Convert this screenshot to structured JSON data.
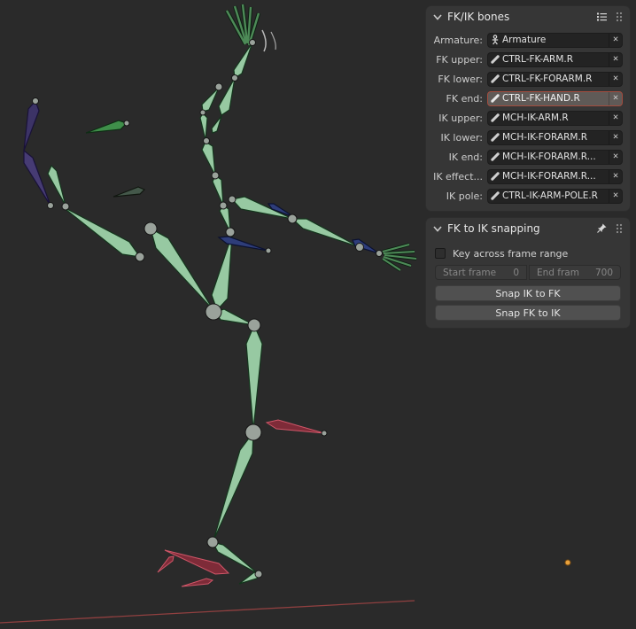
{
  "colors": {
    "viewport_bg": "#2a2a2a",
    "panel_bg": "#363636",
    "field_bg": "#232323",
    "highlight_field_bg": "#5f5a57",
    "highlight_border": "#a34c3e",
    "bone_green": "#97c9a2",
    "bone_dark_green": "#4d8a57",
    "bone_bright_green": "#3f8f4a",
    "bone_red": "#7e2b38",
    "bone_red_outline": "#cf5668",
    "bone_blue": "#2e3d7a",
    "bone_purple": "#3c3366",
    "axis_red": "#9c4343",
    "cursor_orange": "#e8a13c"
  },
  "icons": [
    "chevron-down-icon",
    "presets-list-icon",
    "drag-handle-icon",
    "pin-icon",
    "armature-icon",
    "bone-icon",
    "close-icon",
    "checkbox"
  ],
  "panels": {
    "fkik_bones": {
      "title": "FK/IK bones",
      "rows": [
        {
          "label": "Armature:",
          "value": "Armature"
        },
        {
          "label": "FK upper:",
          "value": "CTRL-FK-ARM.R"
        },
        {
          "label": "FK lower:",
          "value": "CTRL-FK-FORARM.R"
        },
        {
          "label": "FK end:",
          "value": "CTRL-FK-HAND.R"
        },
        {
          "label": "IK upper:",
          "value": "MCH-IK-ARM.R"
        },
        {
          "label": "IK lower:",
          "value": "MCH-IK-FORARM.R"
        },
        {
          "label": "IK end:",
          "value": "MCH-IK-FORARM.R..."
        },
        {
          "label": "IK effect...",
          "value": "MCH-IK-FORARM.R..."
        },
        {
          "label": "IK pole:",
          "value": "CTRL-IK-ARM-POLE.R"
        }
      ],
      "clear_label": "✕"
    },
    "fk_to_ik": {
      "title": "FK to IK snapping",
      "checkbox_label": "Key across frame range",
      "checkbox_checked": false,
      "start_frame_label": "Start frame",
      "start_frame_value": "0",
      "end_frame_label": "End fram",
      "end_frame_value": "700",
      "snap_ik_to_fk": "Snap IK to FK",
      "snap_fk_to_ik": "Snap FK to IK"
    }
  }
}
